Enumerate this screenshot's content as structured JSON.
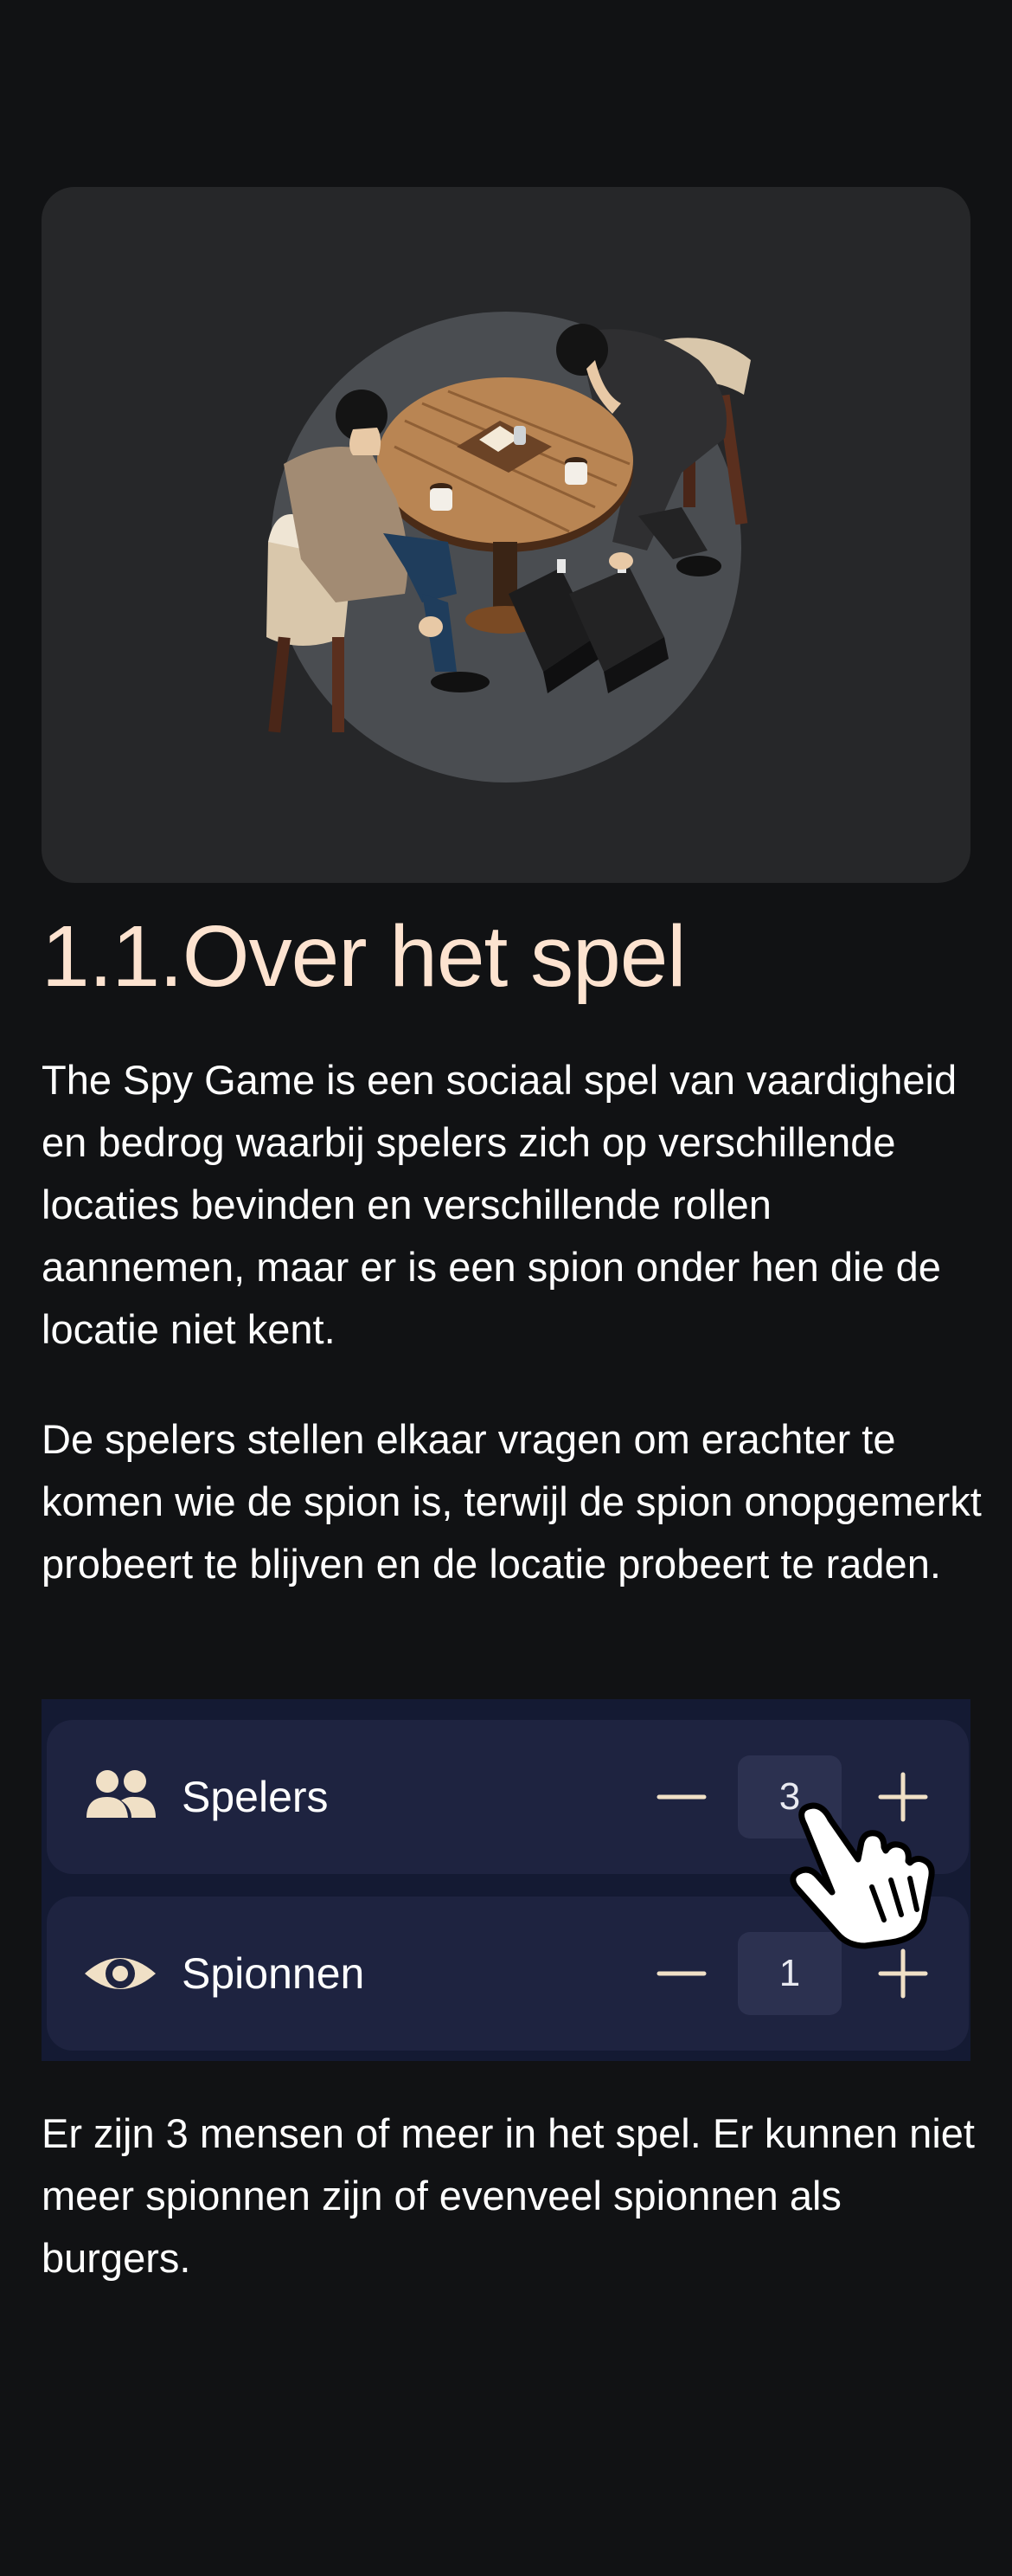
{
  "about": {
    "title": "1.1.Over het spel",
    "paragraph_1": "The Spy Game is een sociaal spel van vaardigheid en bedrog waarbij spelers zich op verschillende locaties bevinden en verschillende rollen aannemen, maar er is een spion onder hen die de locatie niet kent.",
    "paragraph_2": "De spelers stellen elkaar vragen om erachter te komen wie de spion is, terwijl de spion onopgemerkt probeert te blijven en de locatie probeert te raden.",
    "paragraph_3": "Er zijn 3 mensen of meer in het spel. Er kunnen niet meer spionnen zijn of evenveel spionnen als burgers."
  },
  "hero": {
    "illustration": "two-people-at-cafe-table-with-briefcases"
  },
  "settings": {
    "players": {
      "icon": "people-icon",
      "label": "Spelers",
      "count": "3"
    },
    "spies": {
      "icon": "eye-icon",
      "label": "Spionnen",
      "count": "1"
    },
    "cursor_icon": "hand-pointer-icon"
  },
  "colors": {
    "background": "#111214",
    "title": "#fde3d0",
    "panel": "#141a33",
    "row": "#1e2340",
    "counter": "#2c3150",
    "icon": "#f0e0c6"
  }
}
